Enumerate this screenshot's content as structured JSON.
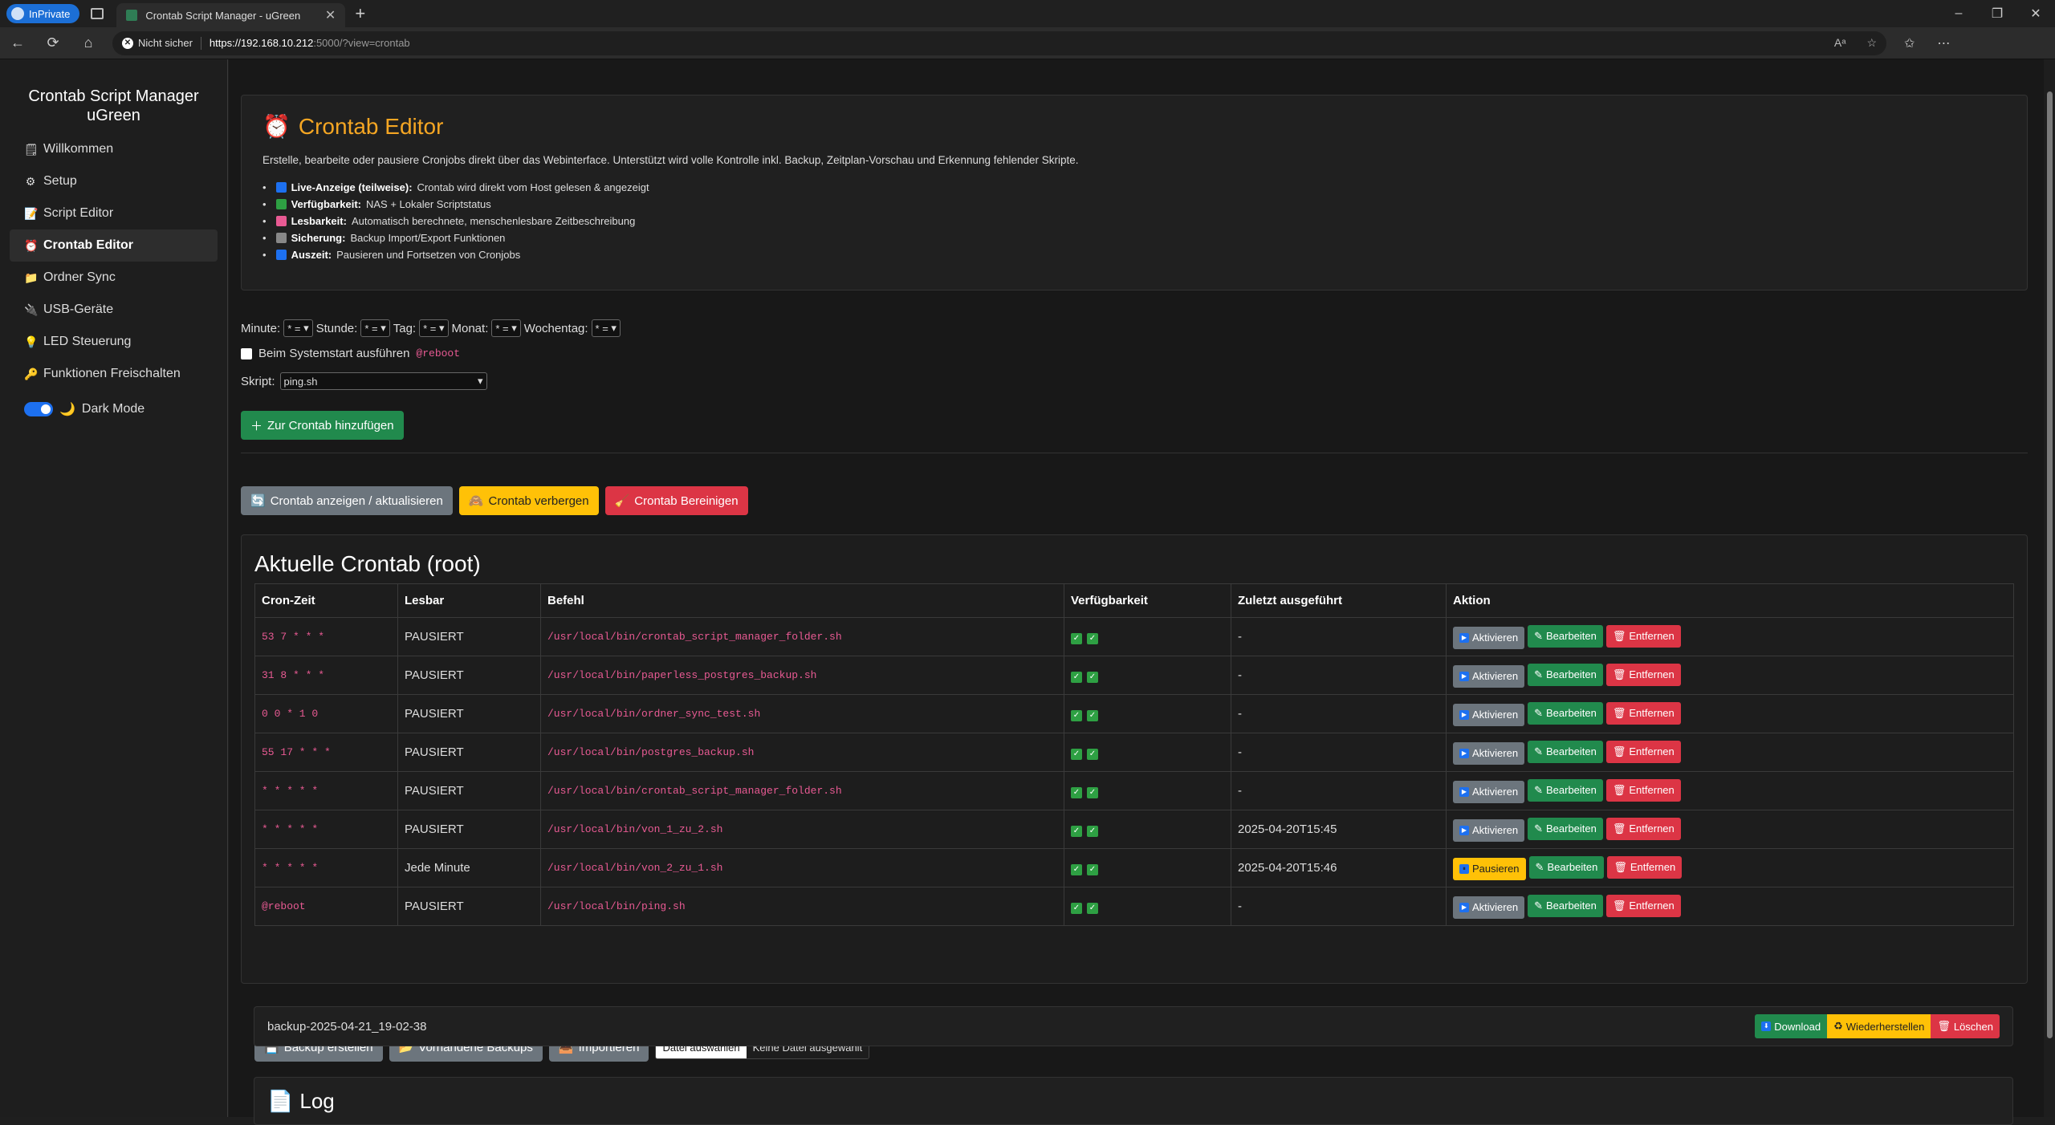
{
  "browser": {
    "inprivate": "InPrivate",
    "tab_title": "Crontab Script Manager - uGreen",
    "insecure": "Nicht sicher",
    "url_proto": "https://",
    "url_host": "192.168.10.212",
    "url_rest": ":5000/?view=crontab"
  },
  "sidebar": {
    "title": "Crontab Script Manager uGreen",
    "items": [
      {
        "label": "Willkommen",
        "icon": "🗒"
      },
      {
        "label": "Setup",
        "icon": "⚙"
      },
      {
        "label": "Script Editor",
        "icon": "📝"
      },
      {
        "label": "Crontab Editor",
        "icon": "⏰"
      },
      {
        "label": "Ordner Sync",
        "icon": "📁"
      },
      {
        "label": "USB-Geräte",
        "icon": "🔌"
      },
      {
        "label": "LED Steuerung",
        "icon": "💡"
      },
      {
        "label": "Funktionen Freischalten",
        "icon": "🔑"
      }
    ],
    "dark_mode": "Dark Mode"
  },
  "intro": {
    "title": "Crontab Editor",
    "description": "Erstelle, bearbeite oder pausiere Cronjobs direkt über das Webinterface. Unterstützt wird volle Kontrolle inkl. Backup, Zeitplan-Vorschau und Erkennung fehlender Skripte.",
    "features": [
      {
        "bold": "Live-Anzeige (teilweise):",
        "text": "Crontab wird direkt vom Host gelesen & angezeigt"
      },
      {
        "bold": "Verfügbarkeit:",
        "text": "NAS + Lokaler Scriptstatus"
      },
      {
        "bold": "Lesbarkeit:",
        "text": "Automatisch berechnete, menschenlesbare Zeitbeschreibung"
      },
      {
        "bold": "Sicherung:",
        "text": "Backup Import/Export Funktionen"
      },
      {
        "bold": "Auszeit:",
        "text": "Pausieren und Fortsetzen von Cronjobs"
      }
    ]
  },
  "form": {
    "minute": "Minute:",
    "stunde": "Stunde:",
    "tag": "Tag:",
    "monat": "Monat:",
    "wochentag": "Wochentag:",
    "select_value": "* =",
    "boot_label": "Beim Systemstart ausführen",
    "boot_code": "@reboot",
    "skript_label": "Skript:",
    "skript_value": "ping.sh",
    "add_button": "Zur Crontab hinzufügen"
  },
  "toolbar": {
    "show": "Crontab anzeigen / aktualisieren",
    "hide": "Crontab verbergen",
    "clean": "Crontab Bereinigen"
  },
  "table": {
    "title": "Aktuelle Crontab (root)",
    "headers": [
      "Cron-Zeit",
      "Lesbar",
      "Befehl",
      "Verfügbarkeit",
      "Zuletzt ausgeführt",
      "Aktion"
    ],
    "rows": [
      {
        "cron": "53 7 * * *",
        "lesbar": "PAUSIERT",
        "cmd": "/usr/local/bin/crontab_script_manager_folder.sh",
        "last": "-",
        "toggle": "Aktivieren",
        "paused": true
      },
      {
        "cron": "31 8 * * *",
        "lesbar": "PAUSIERT",
        "cmd": "/usr/local/bin/paperless_postgres_backup.sh",
        "last": "-",
        "toggle": "Aktivieren",
        "paused": true
      },
      {
        "cron": "0 0 * 1 0",
        "lesbar": "PAUSIERT",
        "cmd": "/usr/local/bin/ordner_sync_test.sh",
        "last": "-",
        "toggle": "Aktivieren",
        "paused": true
      },
      {
        "cron": "55 17 * * *",
        "lesbar": "PAUSIERT",
        "cmd": "/usr/local/bin/postgres_backup.sh",
        "last": "-",
        "toggle": "Aktivieren",
        "paused": true
      },
      {
        "cron": "* * * * *",
        "lesbar": "PAUSIERT",
        "cmd": "/usr/local/bin/crontab_script_manager_folder.sh",
        "last": "-",
        "toggle": "Aktivieren",
        "paused": true
      },
      {
        "cron": "* * * * *",
        "lesbar": "PAUSIERT",
        "cmd": "/usr/local/bin/von_1_zu_2.sh",
        "last": "2025-04-20T15:45",
        "toggle": "Aktivieren",
        "paused": true
      },
      {
        "cron": "* * * * *",
        "lesbar": "Jede Minute",
        "cmd": "/usr/local/bin/von_2_zu_1.sh",
        "last": "2025-04-20T15:46",
        "toggle": "Pausieren",
        "paused": false
      },
      {
        "cron": "@reboot",
        "lesbar": "PAUSIERT",
        "cmd": "/usr/local/bin/ping.sh",
        "last": "-",
        "toggle": "Aktivieren",
        "paused": true
      }
    ],
    "edit": "Bearbeiten",
    "remove": "Entfernen"
  },
  "backup": {
    "create": "Backup erstellen",
    "existing": "Vorhandene Backups",
    "import": "Importieren",
    "choose_file": "Datei auswählen",
    "no_file": "Keine Datei ausgewählt",
    "item_name": "backup-2025-04-21_19-02-38",
    "download": "Download",
    "restore": "Wiederherstellen",
    "delete": "Löschen"
  },
  "log": {
    "title": "Log"
  }
}
